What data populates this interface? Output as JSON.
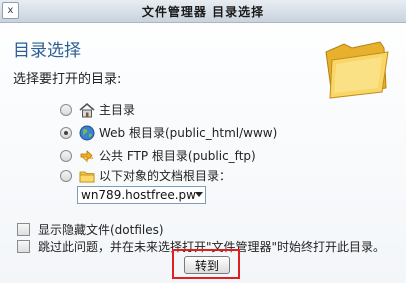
{
  "window": {
    "title": "文件管理器 目录选择",
    "close_glyph": "x"
  },
  "heading": "目录选择",
  "prompt": "选择要打开的目录:",
  "options": [
    {
      "label": "主目录",
      "icon": "home-icon",
      "selected": false
    },
    {
      "label": "Web 根目录(public_html/www)",
      "icon": "globe-icon",
      "selected": true
    },
    {
      "label": "公共 FTP 根目录(public_ftp)",
      "icon": "ftp-icon",
      "selected": false
    },
    {
      "label": "以下对象的文档根目录：",
      "icon": "folder-icon",
      "selected": false
    }
  ],
  "domain_select": {
    "value": "wn789.hostfree.pw"
  },
  "checkboxes": [
    {
      "label": "显示隐藏文件(dotfiles)",
      "checked": false
    },
    {
      "label": "跳过此问题，并在未来选择打开\"文件管理器\"时始终打开此目录。",
      "checked": false
    }
  ],
  "go_button": "转到",
  "colors": {
    "heading": "#2b5f95",
    "highlight": "#e02020",
    "folder": "#f5c443"
  }
}
